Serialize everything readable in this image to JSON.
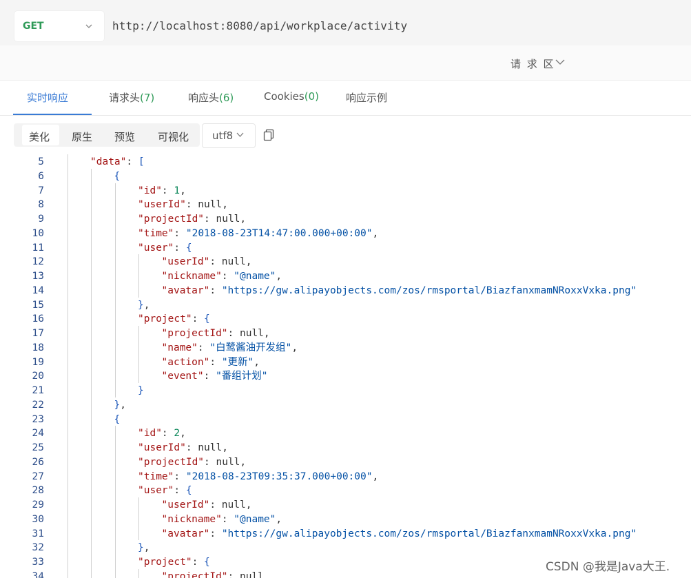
{
  "request": {
    "method": "GET",
    "url": "http://localhost:8080/api/workplace/activity",
    "toggle_label": "请 求 区"
  },
  "tabs": [
    {
      "label": "实时响应",
      "count": ""
    },
    {
      "label": "请求头",
      "count": "(7)"
    },
    {
      "label": "响应头",
      "count": "(6)"
    },
    {
      "label": "Cookies",
      "count": "(0)"
    },
    {
      "label": "响应示例",
      "count": ""
    }
  ],
  "view_modes": [
    "美化",
    "原生",
    "预览",
    "可视化"
  ],
  "encoding": "utf8",
  "code_lines": [
    {
      "n": "5",
      "t": "\"data\": [",
      "ind": 1
    },
    {
      "n": "6",
      "t": "{",
      "ind": 2
    },
    {
      "n": "7",
      "t": "\"id\": 1,",
      "ind": 3
    },
    {
      "n": "8",
      "t": "\"userId\": null,",
      "ind": 3
    },
    {
      "n": "9",
      "t": "\"projectId\": null,",
      "ind": 3
    },
    {
      "n": "10",
      "t": "\"time\": \"2018-08-23T14:47:00.000+00:00\",",
      "ind": 3
    },
    {
      "n": "11",
      "t": "\"user\": {",
      "ind": 3
    },
    {
      "n": "12",
      "t": "\"userId\": null,",
      "ind": 4
    },
    {
      "n": "13",
      "t": "\"nickname\": \"@name\",",
      "ind": 4
    },
    {
      "n": "14",
      "t": "\"avatar\": \"https://gw.alipayobjects.com/zos/rmsportal/BiazfanxmamNRoxxVxka.png\"",
      "ind": 4
    },
    {
      "n": "15",
      "t": "},",
      "ind": 3
    },
    {
      "n": "16",
      "t": "\"project\": {",
      "ind": 3
    },
    {
      "n": "17",
      "t": "\"projectId\": null,",
      "ind": 4
    },
    {
      "n": "18",
      "t": "\"name\": \"白鹭酱油开发组\",",
      "ind": 4
    },
    {
      "n": "19",
      "t": "\"action\": \"更新\",",
      "ind": 4
    },
    {
      "n": "20",
      "t": "\"event\": \"番组计划\"",
      "ind": 4
    },
    {
      "n": "21",
      "t": "}",
      "ind": 3
    },
    {
      "n": "22",
      "t": "},",
      "ind": 2
    },
    {
      "n": "23",
      "t": "{",
      "ind": 2
    },
    {
      "n": "24",
      "t": "\"id\": 2,",
      "ind": 3
    },
    {
      "n": "25",
      "t": "\"userId\": null,",
      "ind": 3
    },
    {
      "n": "26",
      "t": "\"projectId\": null,",
      "ind": 3
    },
    {
      "n": "27",
      "t": "\"time\": \"2018-08-23T09:35:37.000+00:00\",",
      "ind": 3
    },
    {
      "n": "28",
      "t": "\"user\": {",
      "ind": 3
    },
    {
      "n": "29",
      "t": "\"userId\": null,",
      "ind": 4
    },
    {
      "n": "30",
      "t": "\"nickname\": \"@name\",",
      "ind": 4
    },
    {
      "n": "31",
      "t": "\"avatar\": \"https://gw.alipayobjects.com/zos/rmsportal/BiazfanxmamNRoxxVxka.png\"",
      "ind": 4
    },
    {
      "n": "32",
      "t": "},",
      "ind": 3
    },
    {
      "n": "33",
      "t": "\"project\": {",
      "ind": 3
    },
    {
      "n": "34",
      "t": "\"projectId\": null",
      "ind": 4
    }
  ],
  "watermark": "CSDN @我是Java大王.",
  "colors": {
    "method": "#2e9a57",
    "active_tab": "#3a7bd5",
    "json_key": "#a31515",
    "json_string": "#0451a5",
    "json_number": "#098658",
    "bracket": "#1a55b8"
  }
}
